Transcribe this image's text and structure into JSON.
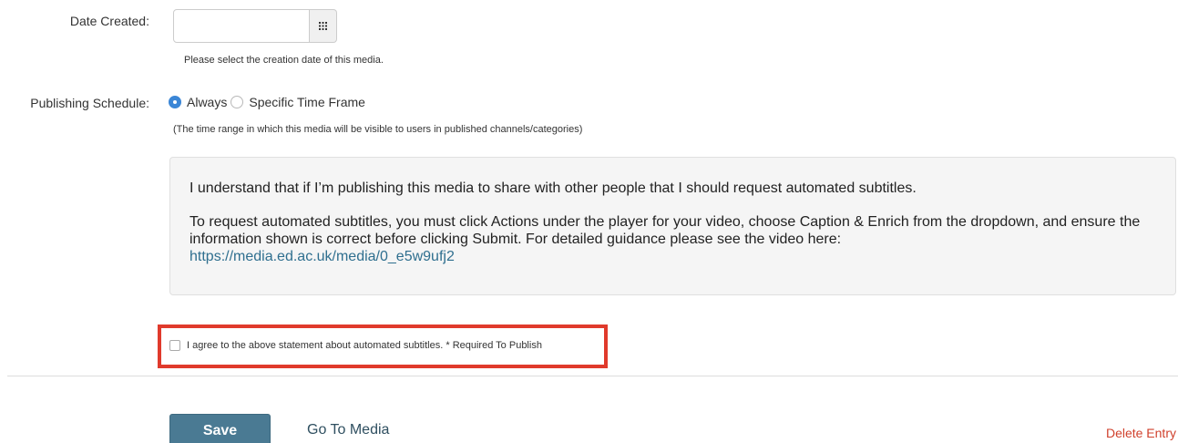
{
  "date_created": {
    "label": "Date Created:",
    "value": "",
    "placeholder": "",
    "calendar_icon": "calendar-grid-icon",
    "help_text": "Please select the creation date of this media."
  },
  "publishing_schedule": {
    "label": "Publishing Schedule:",
    "options": [
      {
        "label": "Always",
        "selected": true
      },
      {
        "label": "Specific Time Frame",
        "selected": false
      }
    ],
    "help_text": "(The time range in which this media will be visible to users in published channels/categories)"
  },
  "notice": {
    "paragraph1": "I understand that if I’m publishing this media to share with other people that I should request automated subtitles.",
    "paragraph2": "To request automated subtitles, you must click Actions under the player for your video, choose Caption & Enrich from the dropdown, and ensure the information shown is correct before clicking Submit.  For detailed guidance please see the video here:",
    "link": "https://media.ed.ac.uk/media/0_e5w9ufj2"
  },
  "agreement": {
    "label": "I agree to the above statement about automated subtitles. * Required To Publish",
    "checked": false,
    "highlight_color": "#e03a2c"
  },
  "actions": {
    "save_label": "Save",
    "goto_label": "Go To Media",
    "delete_label": "Delete Entry"
  },
  "colors": {
    "accent_radio": "#3b86d6",
    "save_button": "#4a7a93",
    "delete_link": "#d0412d",
    "link": "#2f6f8f"
  }
}
